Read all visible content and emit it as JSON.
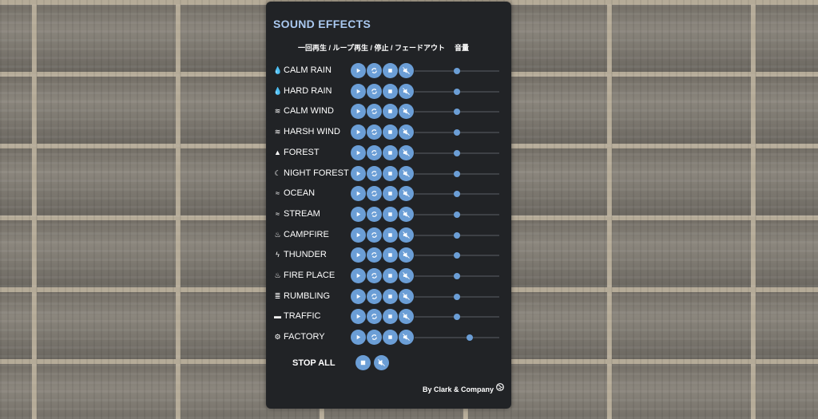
{
  "panel": {
    "title": "SOUND EFFECTS",
    "header": {
      "controls": "一回再生 / ループ再生 / 停止 / フェードアウト",
      "volume": "音量"
    }
  },
  "sounds": [
    {
      "label": "CALM RAIN",
      "icon": "water-drop-icon",
      "volume": 0.5
    },
    {
      "label": "HARD RAIN",
      "icon": "water-drop-icon",
      "volume": 0.5
    },
    {
      "label": "CALM WIND",
      "icon": "wind-icon",
      "volume": 0.5
    },
    {
      "label": "HARSH WIND",
      "icon": "wind-icon",
      "volume": 0.5
    },
    {
      "label": "FOREST",
      "icon": "tree-icon",
      "volume": 0.5
    },
    {
      "label": "NIGHT FOREST",
      "icon": "moon-icon",
      "volume": 0.5
    },
    {
      "label": "OCEAN",
      "icon": "waves-icon",
      "volume": 0.5
    },
    {
      "label": "STREAM",
      "icon": "water-icon",
      "volume": 0.5
    },
    {
      "label": "CAMPFIRE",
      "icon": "fire-icon",
      "volume": 0.5
    },
    {
      "label": "THUNDER",
      "icon": "bolt-icon",
      "volume": 0.5
    },
    {
      "label": "FIRE PLACE",
      "icon": "fire-icon",
      "volume": 0.5
    },
    {
      "label": "RUMBLING",
      "icon": "rumble-icon",
      "volume": 0.5
    },
    {
      "label": "TRAFFIC",
      "icon": "car-icon",
      "volume": 0.5
    },
    {
      "label": "FACTORY",
      "icon": "gear-icon",
      "volume": 0.65
    }
  ],
  "stop_all": {
    "label": "STOP ALL"
  },
  "footer": {
    "credit": "By Clark & Company",
    "icon": "globe-icon"
  },
  "colors": {
    "accent": "#6b9ed6",
    "title": "#a9c8ef",
    "panel": "#212326"
  }
}
